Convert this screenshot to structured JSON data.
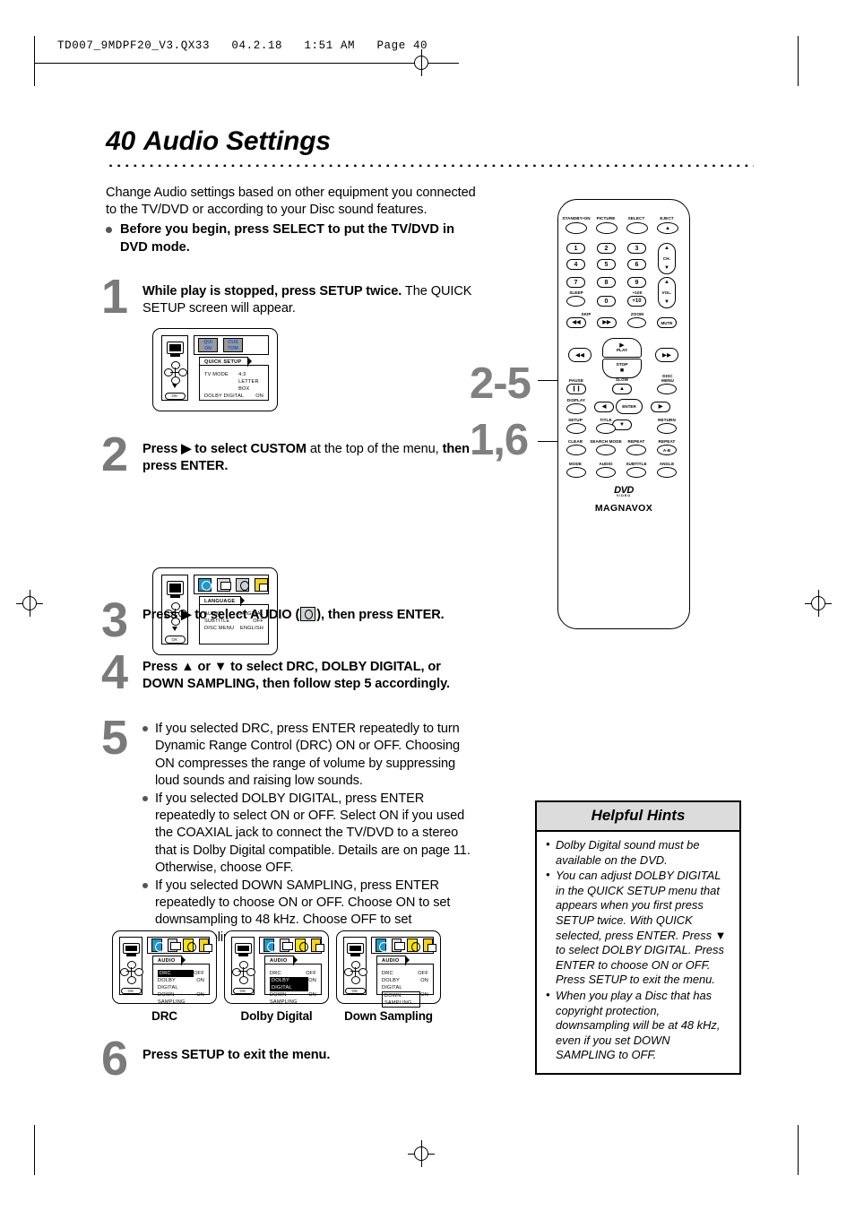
{
  "print_header": "TD007_9MDPF20_V3.QX33   04.2.18   1:51 AM   Page 40",
  "title": {
    "number": "40",
    "text": "Audio Settings"
  },
  "intro": {
    "paragraph": "Change Audio settings based on other equipment you connected to the TV/DVD or according to your Disc sound features.",
    "bullet": "Before you begin, press SELECT to put the TV/DVD in DVD mode."
  },
  "steps": [
    {
      "num": "1",
      "text_html": "<b>While play is stopped, press SETUP twice.</b> The QUICK SETUP screen will appear."
    },
    {
      "num": "2",
      "text_html": "<b>Press ▶ to select CUSTOM</b> at the top of the menu, <b>then press ENTER.</b>"
    },
    {
      "num": "3",
      "text_html": "<b>Press ▶ to select AUDIO (</b>ICON<b>), then press ENTER.</b>"
    },
    {
      "num": "4",
      "text_html": "<b>Press ▲ or ▼ to select DRC, DOLBY DIGITAL, or DOWN SAMPLING, then follow step 5 accordingly.</b>"
    },
    {
      "num": "5",
      "bullets": [
        "If you selected DRC, press ENTER repeatedly to turn Dynamic Range Control (DRC) ON or OFF.  Choosing ON compresses the range of volume by suppressing loud sounds and raising low sounds.",
        "If you selected DOLBY DIGITAL, press ENTER repeatedly to select ON or OFF.  Select ON if you used the COAXIAL jack to connect the TV/DVD to a stereo that is Dolby Digital compatible.  Details are on page 11.  Otherwise, choose OFF.",
        "If you selected DOWN SAMPLING, press ENTER repeatedly to choose ON or OFF.  Choose ON to set downsampling to 48 kHz. Choose OFF to set downsampling to 96 kHz."
      ]
    },
    {
      "num": "6",
      "text_html": "<b>Press SETUP to exit the menu.</b>"
    }
  ],
  "osd_screens": {
    "quick_setup": {
      "tab": "QUICK SETUP",
      "top_icons": [
        "QUICK ON",
        "QUICK CUSTOM"
      ],
      "rows": [
        {
          "key": "TV MODE",
          "value": "4:3 LETTER BOX"
        },
        {
          "key": "DOLBY DIGITAL",
          "value": "ON"
        }
      ]
    },
    "language": {
      "tab": "LANGUAGE",
      "top_icons": [
        "globe-icon",
        "display-icon",
        "audio-icon",
        "lock-icon"
      ],
      "rows": [
        {
          "key": "AUDIO",
          "value": "ORIGINAL"
        },
        {
          "key": "SUBTITLE",
          "value": "OFF"
        },
        {
          "key": "DISC MENU",
          "value": "ENGLISH"
        }
      ]
    },
    "audio_variants": [
      {
        "caption": "DRC",
        "tab": "AUDIO",
        "rows": [
          {
            "key": "DRC",
            "value": "OFF",
            "highlight": "fill"
          },
          {
            "key": "DOLBY DIGITAL",
            "value": "ON",
            "highlight": "none"
          },
          {
            "key": "DOWN SAMPLING",
            "value": "ON",
            "highlight": "none"
          }
        ]
      },
      {
        "caption": "Dolby Digital",
        "tab": "AUDIO",
        "rows": [
          {
            "key": "DRC",
            "value": "OFF",
            "highlight": "none"
          },
          {
            "key": "DOLBY DIGITAL",
            "value": "ON",
            "highlight": "fill"
          },
          {
            "key": "DOWN SAMPLING",
            "value": "ON",
            "highlight": "none"
          }
        ]
      },
      {
        "caption": "Down Sampling",
        "tab": "AUDIO",
        "rows": [
          {
            "key": "DRC",
            "value": "OFF",
            "highlight": "none"
          },
          {
            "key": "DOLBY DIGITAL",
            "value": "ON",
            "highlight": "none"
          },
          {
            "key": "DOWN SAMPLING",
            "value": "ON",
            "highlight": "box"
          }
        ]
      }
    ]
  },
  "callouts": {
    "upper": "2-5",
    "lower": "1,6"
  },
  "remote": {
    "brand": "MAGNAVOX",
    "logo": "DVD",
    "logo_sub": "VIDEO",
    "top_row": [
      "STANDBY•ON",
      "PICTURE",
      "SELECT",
      "EJECT"
    ],
    "keypad": [
      "1",
      "2",
      "3",
      "4",
      "5",
      "6",
      "7",
      "8",
      "9",
      "0"
    ],
    "plus_ten": "+10",
    "plus_hundred": "+100",
    "sleep": "SLEEP",
    "ch": "CH.",
    "vol": "VOL.",
    "skip": "SKIP",
    "zoom": "ZOOM",
    "mute": "MUTE",
    "play": "PLAY",
    "stop": "STOP",
    "slow": "SLOW",
    "pause": "PAUSE",
    "display": "DISPLAY",
    "disc_menu": "DISC MENU",
    "enter": "ENTER",
    "setup": "SETUP",
    "title_btn": "TITLE",
    "return_btn": "RETURN",
    "clear": "CLEAR",
    "search_mode": "SEARCH MODE",
    "repeat": "REPEAT",
    "repeat_ab": "REPEAT",
    "repeat_ab_sub": "A-B",
    "mode": "MODE",
    "audio": "AUDIO",
    "subtitle": "SUBTITLE",
    "angle": "ANGLE"
  },
  "hints": {
    "title": "Helpful Hints",
    "items": [
      "Dolby Digital sound must be available on the DVD.",
      "You can adjust DOLBY DIGITAL in the QUICK SETUP menu that appears when you first press SETUP twice. With QUICK selected, press ENTER.  Press ▼ to select DOLBY DIGITAL.  Press ENTER to choose ON or OFF. Press SETUP to exit the menu.",
      "When you play a Disc that has copyright protection, downsampling will be at 48 kHz, even if you set DOWN SAMPLING to OFF."
    ]
  }
}
